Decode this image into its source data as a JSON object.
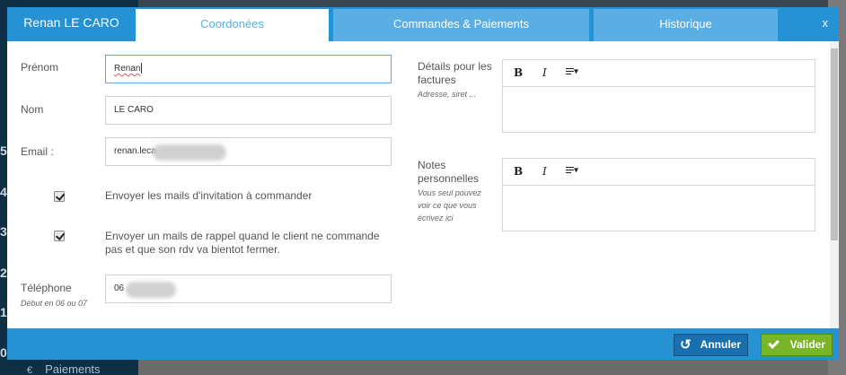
{
  "background": {
    "bottom_item": "Paiements",
    "euro_symbol": "€",
    "day_numbers": [
      "5",
      "4",
      "3",
      "2",
      "1",
      "0"
    ]
  },
  "modal": {
    "title": "Renan LE CARO",
    "tabs": [
      {
        "label": "Coordonées",
        "active": true
      },
      {
        "label": "Commandes & Paiements",
        "active": false
      },
      {
        "label": "Historique",
        "active": false
      }
    ],
    "close_label": "x"
  },
  "form": {
    "prenom": {
      "label": "Prénom",
      "value": "Renan"
    },
    "nom": {
      "label": "Nom",
      "value": "LE CARO"
    },
    "email": {
      "label": "Email :",
      "value": "renan.leca"
    },
    "checkbox_invite": {
      "label": "Envoyer les mails d'invitation à commander",
      "checked": true
    },
    "checkbox_reminder": {
      "label_line1": "Envoyer un mails de rappel quand le client ne commande",
      "label_line2": "pas et que son rdv va bientot fermer.",
      "checked": true
    },
    "telephone": {
      "label": "Téléphone",
      "hint": "Début en 06 ou 07",
      "value": "06 ."
    },
    "details": {
      "label_line1": "Détails pour les",
      "label_line2": "factures",
      "hint": "Adresse, siret ..."
    },
    "notes": {
      "label_line1": "Notes",
      "label_line2": "personnelles",
      "hint_line1": "Vous seul pouvez",
      "hint_line2": "voir ce que vous",
      "hint_line3": "écrivez ici"
    },
    "toolbar": {
      "bold": "B",
      "italic": "I"
    }
  },
  "footer": {
    "cancel_label": "Annuler",
    "confirm_label": "Valider"
  },
  "colors": {
    "header_blue": "#2792d3",
    "tab_inactive": "#5aaee3",
    "cancel_button": "#1a6fae",
    "confirm_button": "#78b628"
  }
}
